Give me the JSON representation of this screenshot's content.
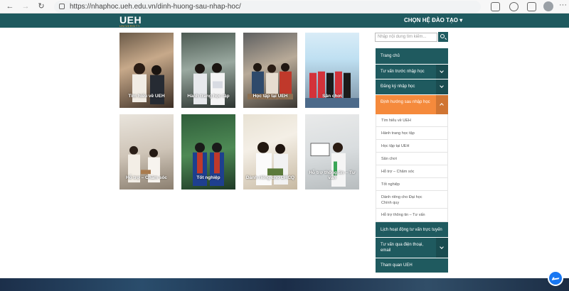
{
  "browser": {
    "url": "https://nhaphoc.ueh.edu.vn/dinh-huong-sau-nhap-hoc/"
  },
  "header": {
    "logo": "UEH",
    "logo_sub": "UNIVERSITY",
    "program_menu": "CHỌN HỆ ĐÀO TẠO ▾"
  },
  "cards": [
    {
      "label": "Tìm hiểu về UEH"
    },
    {
      "label": "Hành trang học tập"
    },
    {
      "label": "Học tập tại UEH"
    },
    {
      "label": "Sân chơi"
    },
    {
      "label": "Hỗ trợ – Chăm sóc"
    },
    {
      "label": "Tốt nghiệp"
    },
    {
      "label": "Dành riêng cho ĐHCQ"
    },
    {
      "label": "Hỗ trợ thông tin – Tư vấn"
    }
  ],
  "sidebar": {
    "search_placeholder": "Nhập nội dung tìm kiếm...",
    "items": [
      {
        "label": "Trang chủ"
      },
      {
        "label": "Tư vấn trước nhập học"
      },
      {
        "label": "Đăng ký nhập học"
      },
      {
        "label": "Định hướng sau nhập học"
      },
      {
        "label": "Lịch hoạt động tư vấn trực tuyến"
      },
      {
        "label": "Tư vấn qua điện thoại, email"
      },
      {
        "label": "Tham quan UEH"
      }
    ],
    "subitems": [
      {
        "label": "Tìm hiểu về UEH"
      },
      {
        "label": "Hành trang học tập"
      },
      {
        "label": "Học tập tại UEH"
      },
      {
        "label": "Sân chơi"
      },
      {
        "label": "Hỗ trợ – Chăm sóc"
      },
      {
        "label": "Tốt nghiệp"
      },
      {
        "label": "Dành riêng cho Đại học Chính quy"
      },
      {
        "label": "Hỗ trợ thông tin – Tư vấn"
      }
    ]
  }
}
